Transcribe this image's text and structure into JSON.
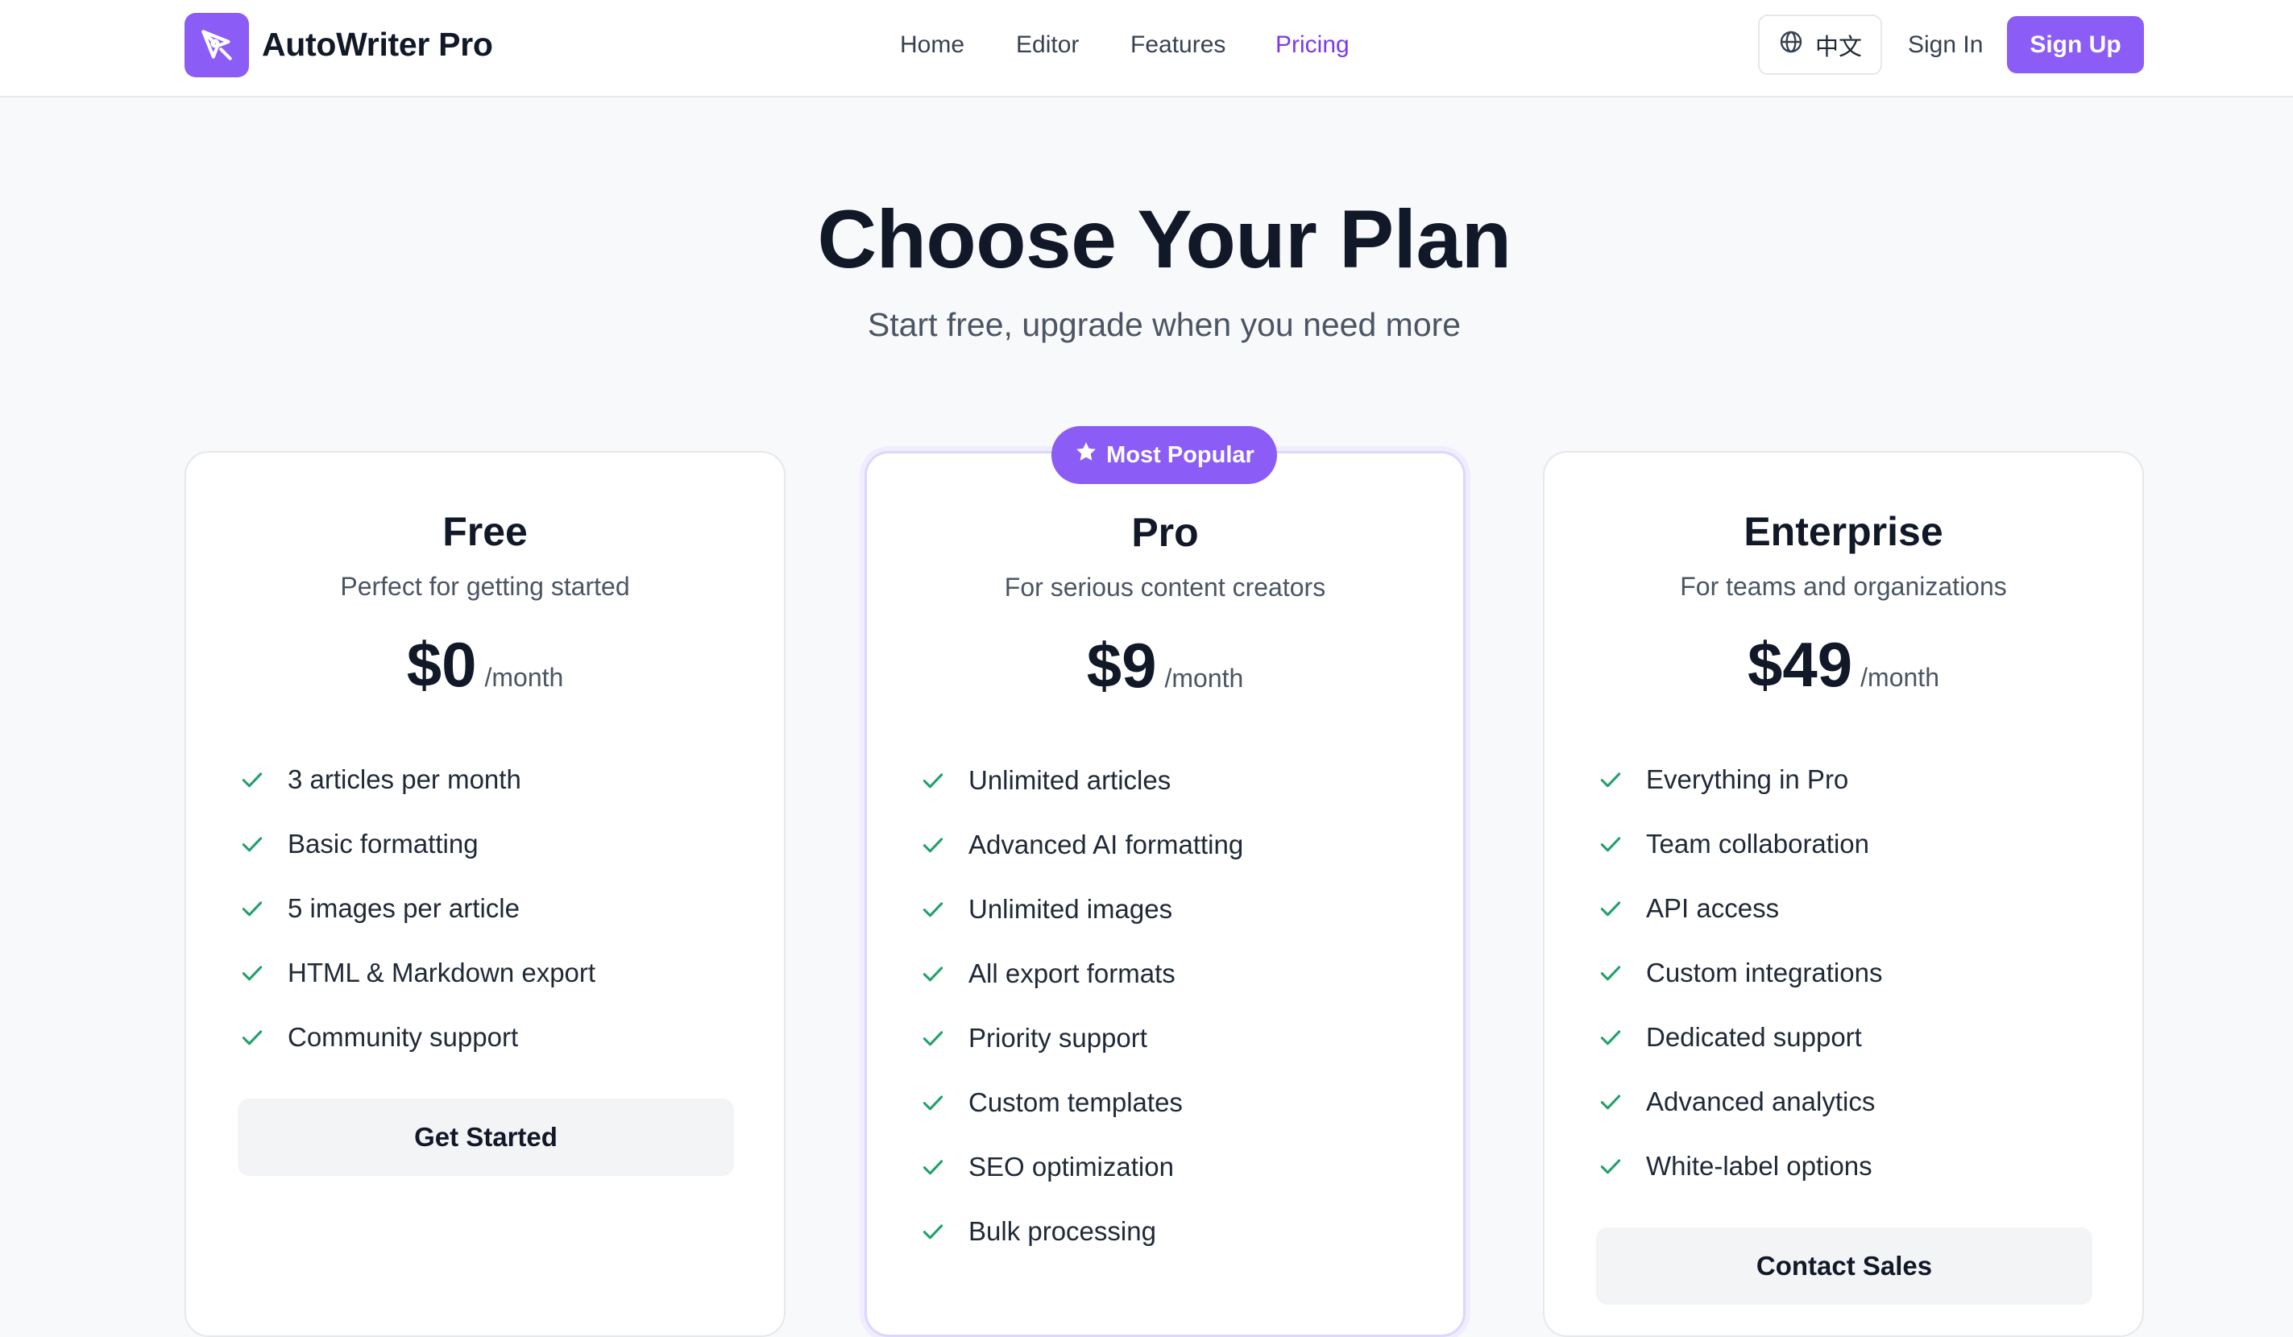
{
  "header": {
    "brand": "AutoWriter Pro",
    "nav": [
      {
        "label": "Home",
        "active": false
      },
      {
        "label": "Editor",
        "active": false
      },
      {
        "label": "Features",
        "active": false
      },
      {
        "label": "Pricing",
        "active": true
      }
    ],
    "language_label": "中文",
    "signin_label": "Sign In",
    "signup_label": "Sign Up"
  },
  "hero": {
    "title": "Choose Your Plan",
    "subtitle": "Start free, upgrade when you need more"
  },
  "plans": [
    {
      "name": "Free",
      "description": "Perfect for getting started",
      "price": "$0",
      "period": "/month",
      "features": [
        "3 articles per month",
        "Basic formatting",
        "5 images per article",
        "HTML & Markdown export",
        "Community support"
      ],
      "cta": "Get Started"
    },
    {
      "name": "Pro",
      "badge": "Most Popular",
      "description": "For serious content creators",
      "price": "$9",
      "period": "/month",
      "features": [
        "Unlimited articles",
        "Advanced AI formatting",
        "Unlimited images",
        "All export formats",
        "Priority support",
        "Custom templates",
        "SEO optimization",
        "Bulk processing"
      ]
    },
    {
      "name": "Enterprise",
      "description": "For teams and organizations",
      "price": "$49",
      "period": "/month",
      "features": [
        "Everything in Pro",
        "Team collaboration",
        "API access",
        "Custom integrations",
        "Dedicated support",
        "Advanced analytics",
        "White-label options"
      ],
      "cta": "Contact Sales"
    }
  ],
  "colors": {
    "accent": "#8b5cf6",
    "accent_text": "#7c3aed",
    "check": "#22a06b"
  },
  "icons": {
    "logo": "pen-nib-icon",
    "language": "globe-icon",
    "badge": "star-icon",
    "feature": "check-icon"
  }
}
